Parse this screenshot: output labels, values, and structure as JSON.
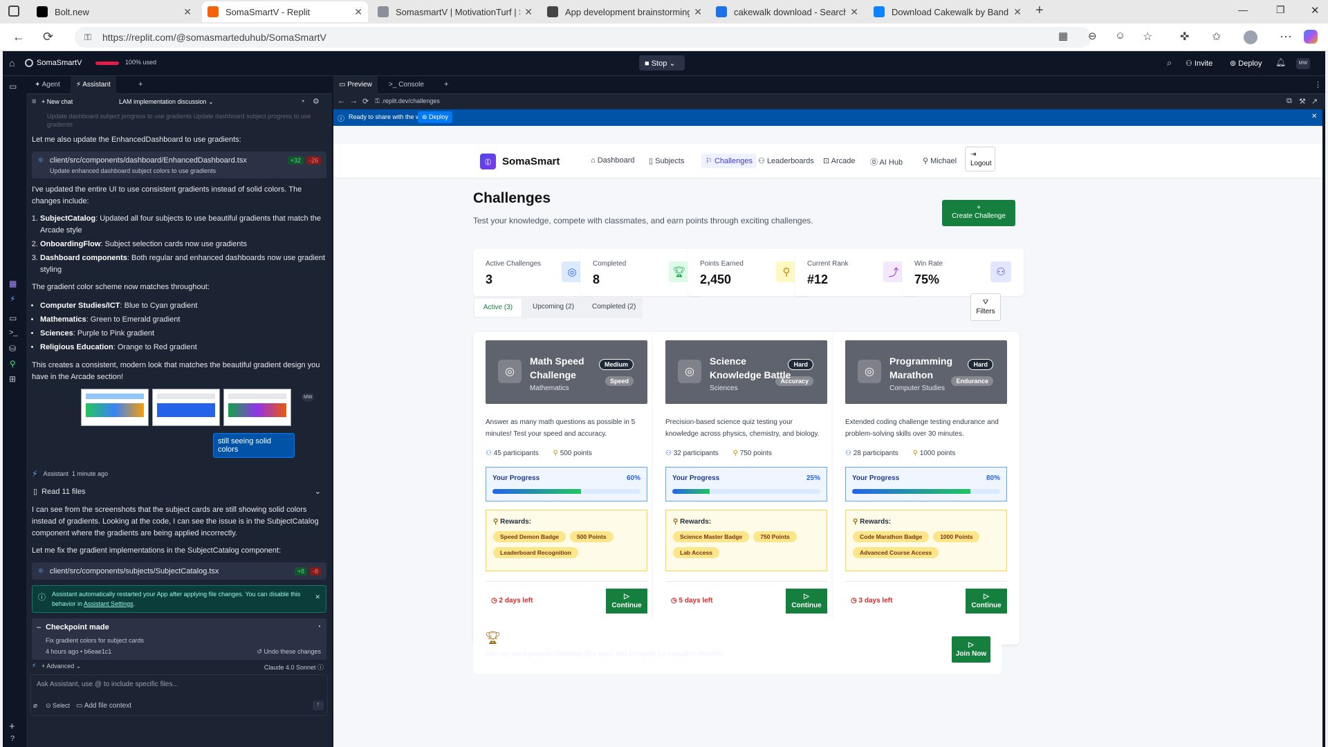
{
  "browser": {
    "tabs": [
      {
        "title": "Bolt.new",
        "color": "#000000"
      },
      {
        "title": "SomaSmartV - Replit",
        "color": "#f26207",
        "active": true
      },
      {
        "title": "SomasmartV | MotivationTurf | Su",
        "color": "#8a8f98"
      },
      {
        "title": "App development brainstorming",
        "color": "#444444"
      },
      {
        "title": "cakewalk download - Search",
        "color": "#1a73e8"
      },
      {
        "title": "Download Cakewalk by BandLab",
        "color": "#0a84ff"
      }
    ],
    "url": "https://replit.com/@somasmarteduhub/SomaSmartV"
  },
  "replit": {
    "project": "SomaSmartV",
    "usage": "100% used",
    "stop": "Stop",
    "invite": "Invite",
    "deploy": "Deploy",
    "avatar": "MW",
    "left_tabs": [
      "Agent",
      "Assistant"
    ],
    "new_chat": "New chat",
    "chat_title": "LAM implementation discussion",
    "right_tabs": [
      "Preview",
      "Console"
    ],
    "preview_url": ".replit.dev/challenges",
    "banner": "Ready to share with the world?",
    "banner_deploy": "Deploy"
  },
  "chat": {
    "faded": "Update dashboard subject progress to use gradients Update dashboard subject progress to use gradients",
    "p1": "Let me also update the EnhancedDashboard to use gradients:",
    "file1": {
      "path": "client/src/components/dashboard/EnhancedDashboard.tsx",
      "add": "+32",
      "del": "-26",
      "desc": "Update enhanced dashboard subject colors to use gradients"
    },
    "p2": "I've updated the entire UI to use consistent gradients instead of solid colors. The changes include:",
    "list1": [
      {
        "b": "SubjectCatalog",
        "t": ": Updated all four subjects to use beautiful gradients that match the Arcade style"
      },
      {
        "b": "OnboardingFlow",
        "t": ": Subject selection cards now use gradients"
      },
      {
        "b": "Dashboard components",
        "t": ": Both regular and enhanced dashboards now use gradient styling"
      }
    ],
    "p3": "The gradient color scheme now matches throughout:",
    "list2": [
      {
        "b": "Computer Studies/ICT",
        "t": ": Blue to Cyan gradient"
      },
      {
        "b": "Mathematics",
        "t": ": Green to Emerald gradient"
      },
      {
        "b": "Sciences",
        "t": ": Purple to Pink gradient"
      },
      {
        "b": "Religious Education",
        "t": ": Orange to Red gradient"
      }
    ],
    "p4": "This creates a consistent, modern look that matches the beautiful gradient design you have in the Arcade section!",
    "user_msg": "still seeing solid colors",
    "user_avatar": "MW",
    "assistant": "Assistant",
    "time": "1 minute ago",
    "read": "Read 11 files",
    "p5": "I can see from the screenshots that the subject cards are still showing solid colors instead of gradients. Looking at the code, I can see the issue is in the SubjectCatalog component where the gradients are being applied incorrectly.",
    "p6": "Let me fix the gradient implementations in the SubjectCatalog component:",
    "file2": {
      "path": "client/src/components/subjects/SubjectCatalog.tsx",
      "add": "+8",
      "del": "-8"
    },
    "notice": "Assistant automatically restarted your App after applying file changes. You can disable this behavior in",
    "notice_link": "Assistant Settings",
    "checkpoint": "Checkpoint made",
    "checkpoint_desc": "Fix gradient colors for subject cards",
    "checkpoint_time": "4 hours ago",
    "checkpoint_hash": "b6eae1c1",
    "undo": "Undo these changes",
    "advanced": "Advanced",
    "model": "Claude 4.0 Sonnet",
    "input_placeholder": "Ask Assistant, use @ to include specific files...",
    "select": "Select",
    "add_context": "Add file context"
  },
  "app": {
    "brand": "SomaSmart",
    "nav": [
      "Dashboard",
      "Subjects",
      "Challenges",
      "Leaderboards",
      "Arcade",
      "AI Hub",
      "Michael"
    ],
    "logout": "Logout",
    "title": "Challenges",
    "subtitle": "Test your knowledge, compete with classmates, and earn points through exciting challenges.",
    "create": "Create Challenge",
    "stats": [
      {
        "label": "Active Challenges",
        "value": "3",
        "icon": "target-icon",
        "color": "#dbeafe",
        "fg": "#2563eb"
      },
      {
        "label": "Completed",
        "value": "8",
        "icon": "trophy-icon",
        "color": "#dcfce7",
        "fg": "#16a34a"
      },
      {
        "label": "Points Earned",
        "value": "2,450",
        "icon": "award-icon",
        "color": "#fef9c3",
        "fg": "#ca8a04"
      },
      {
        "label": "Current Rank",
        "value": "#12",
        "icon": "trending-up-icon",
        "color": "#f3e8ff",
        "fg": "#9333ea"
      },
      {
        "label": "Win Rate",
        "value": "75%",
        "icon": "users-icon",
        "color": "#e0e7ff",
        "fg": "#4f46e5"
      }
    ],
    "filter_tabs": [
      "Active (3)",
      "Upcoming (2)",
      "Completed (2)"
    ],
    "filters": "Filters",
    "challenges": [
      {
        "title": "Math Speed Challenge",
        "subject": "Mathematics",
        "difficulty": "Medium",
        "type": "Speed",
        "desc": "Answer as many math questions as possible in 5 minutes! Test your speed and accuracy.",
        "participants": "45 participants",
        "points": "500 points",
        "progress_label": "Your Progress",
        "progress": "60%",
        "progress_value": 0.6,
        "rewards_label": "Rewards:",
        "rewards": [
          "Speed Demon Badge",
          "500 Points",
          "Leaderboard Recognition"
        ],
        "days": "2 days left",
        "action": "Continue"
      },
      {
        "title": "Science Knowledge Battle",
        "subject": "Sciences",
        "difficulty": "Hard",
        "type": "Accuracy",
        "desc": "Precision-based science quiz testing your knowledge across physics, chemistry, and biology.",
        "participants": "32 participants",
        "points": "750 points",
        "progress_label": "Your Progress",
        "progress": "25%",
        "progress_value": 0.25,
        "rewards_label": "Rewards:",
        "rewards": [
          "Science Master Badge",
          "750 Points",
          "Lab Access"
        ],
        "days": "5 days left",
        "action": "Continue"
      },
      {
        "title": "Programming Marathon",
        "subject": "Computer Studies",
        "difficulty": "Hard",
        "type": "Endurance",
        "desc": "Extended coding challenge testing endurance and problem-solving skills over 30 minutes.",
        "participants": "28 participants",
        "points": "1000 points",
        "progress_label": "Your Progress",
        "progress": "80%",
        "progress_value": 0.8,
        "rewards_label": "Rewards:",
        "rewards": [
          "Code Marathon Badge",
          "1000 Points",
          "Advanced Course Access"
        ],
        "days": "3 days left",
        "action": "Continue"
      }
    ],
    "promo_text": "Join our most popular challenge this week and compete for exclusive rewards!",
    "join": "Join Now"
  }
}
